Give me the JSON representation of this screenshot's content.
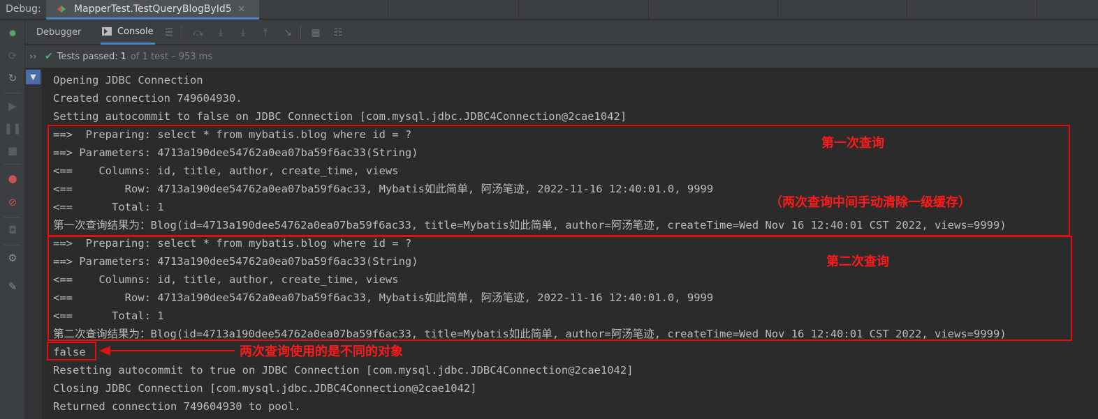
{
  "window": {
    "debug_label": "Debug:",
    "tab_title": "MapperTest.TestQueryBlogById5",
    "tab_close": "×"
  },
  "left_toolbar": {
    "icons": [
      "bug-icon",
      "rerun-icon",
      "restore-icon",
      "resume-icon",
      "pause-icon",
      "stop-icon",
      "breakpoints-icon",
      "mute-breakpoints-icon",
      "camera-icon",
      "settings-icon",
      "pin-icon"
    ]
  },
  "toolbar": {
    "debugger_tab": "Debugger",
    "console_tab": "Console"
  },
  "status": {
    "chevron": "››",
    "passed_label": "Tests passed:",
    "count": "1",
    "detail": "of 1 test – 953 ms"
  },
  "console": {
    "lines": [
      "Opening JDBC Connection",
      "Created connection 749604930.",
      "Setting autocommit to false on JDBC Connection [com.mysql.jdbc.JDBC4Connection@2cae1042]",
      "==>  Preparing: select * from mybatis.blog where id = ?",
      "==> Parameters: 4713a190dee54762a0ea07ba59f6ac33(String)",
      "<==    Columns: id, title, author, create_time, views",
      "<==        Row: 4713a190dee54762a0ea07ba59f6ac33, Mybatis如此简单, 阿汤笔迹, 2022-11-16 12:40:01.0, 9999",
      "<==      Total: 1",
      "第一次查询结果为：Blog(id=4713a190dee54762a0ea07ba59f6ac33, title=Mybatis如此简单, author=阿汤笔迹, createTime=Wed Nov 16 12:40:01 CST 2022, views=9999)",
      "==>  Preparing: select * from mybatis.blog where id = ?",
      "==> Parameters: 4713a190dee54762a0ea07ba59f6ac33(String)",
      "<==    Columns: id, title, author, create_time, views",
      "<==        Row: 4713a190dee54762a0ea07ba59f6ac33, Mybatis如此简单, 阿汤笔迹, 2022-11-16 12:40:01.0, 9999",
      "<==      Total: 1",
      "第二次查询结果为：Blog(id=4713a190dee54762a0ea07ba59f6ac33, title=Mybatis如此简单, author=阿汤笔迹, createTime=Wed Nov 16 12:40:01 CST 2022, views=9999)",
      "false",
      "Resetting autocommit to true on JDBC Connection [com.mysql.jdbc.JDBC4Connection@2cae1042]",
      "Closing JDBC Connection [com.mysql.jdbc.JDBC4Connection@2cae1042]",
      "Returned connection 749604930 to pool."
    ]
  },
  "annotations": {
    "first_query": "第一次查询",
    "clear_cache": "（两次查询中间手动清除一级缓存）",
    "second_query": "第二次查询",
    "different_objects": "两次查询使用的是不同的对象",
    "color": "#e01010"
  }
}
